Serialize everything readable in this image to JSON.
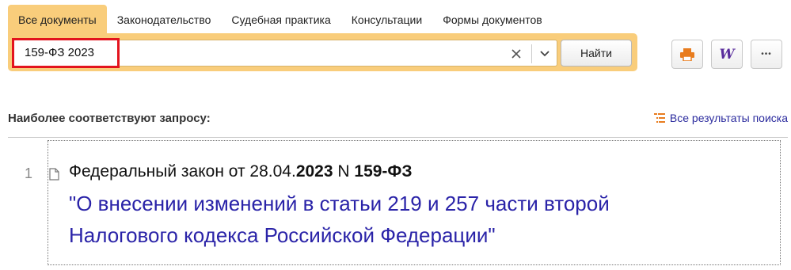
{
  "tabs": [
    {
      "label": "Все документы",
      "active": true
    },
    {
      "label": "Законодательство",
      "active": false
    },
    {
      "label": "Судебная практика",
      "active": false
    },
    {
      "label": "Консультации",
      "active": false
    },
    {
      "label": "Формы документов",
      "active": false
    }
  ],
  "search": {
    "query": "159-ФЗ 2023",
    "find_label": "Найти"
  },
  "toolbar": {
    "icons": [
      "print-icon",
      "word-export-icon",
      "more-icon"
    ],
    "word_glyph": "W",
    "more_glyph": "•••"
  },
  "results": {
    "section_title": "Наиболее соответствуют запросу:",
    "all_results_label": "Все результаты поиска",
    "items": [
      {
        "number": "1",
        "prefix": "Федеральный закон от 28.04.",
        "year": "2023",
        "n_label": " N ",
        "doc_number": "159-ФЗ",
        "title_line1": "\"О внесении изменений в статьи 219 и 257 части второй",
        "title_line2": "Налогового кодекса Российской Федерации\""
      }
    ]
  },
  "colors": {
    "accent_panel": "#f9cd7b",
    "highlight_border": "#e3141e",
    "link": "#2a23a8",
    "icon_orange": "#e87c1e",
    "icon_purple": "#5a2d9c"
  }
}
